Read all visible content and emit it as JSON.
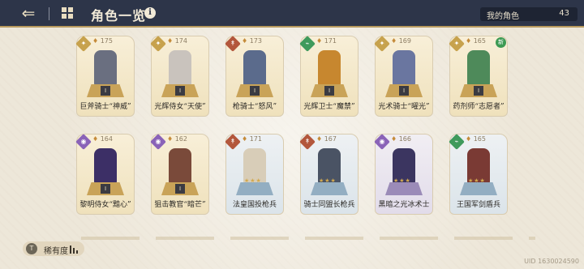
{
  "header": {
    "title": "角色一览",
    "my_chars_label": "我的角色",
    "my_chars_count": "43"
  },
  "cards": [
    {
      "power": "175",
      "name": "巨斧骑士“神威”",
      "rank": "I",
      "badge": "gold",
      "frame": "gold",
      "sprite": "#6a6f80",
      "new": false
    },
    {
      "power": "174",
      "name": "光辉侍女“天使”",
      "rank": "I",
      "badge": "gold",
      "frame": "gold",
      "sprite": "#c9c3bd",
      "new": false
    },
    {
      "power": "173",
      "name": "枪骑士“怒风”",
      "rank": "I",
      "badge": "red",
      "frame": "gold",
      "sprite": "#5b6b8c",
      "new": false
    },
    {
      "power": "171",
      "name": "光辉卫士“魔禁”",
      "rank": "I",
      "badge": "green",
      "frame": "gold",
      "sprite": "#c7872f",
      "new": false
    },
    {
      "power": "169",
      "name": "光术骑士“曜光”",
      "rank": "I",
      "badge": "gold",
      "frame": "gold",
      "sprite": "#6a76a0",
      "new": false
    },
    {
      "power": "165",
      "name": "药剂师“志愿者”",
      "rank": "I",
      "badge": "gold",
      "frame": "gold",
      "sprite": "#4e8a5a",
      "new": true,
      "new_label": "新"
    },
    {
      "power": "164",
      "name": "黎明侍女“黯心”",
      "rank": "I",
      "badge": "purple",
      "frame": "gold",
      "sprite": "#3c2f66",
      "new": false
    },
    {
      "power": "162",
      "name": "狙击教官“暗芒”",
      "rank": "I",
      "badge": "purple",
      "frame": "gold",
      "sprite": "#7a4a3a",
      "new": false
    },
    {
      "power": "171",
      "name": "法皇国投枪兵",
      "rank": "",
      "badge": "red",
      "frame": "blue",
      "sprite": "#d8cdb8",
      "new": false,
      "stars": "★★★"
    },
    {
      "power": "167",
      "name": "骑士同盟长枪兵",
      "rank": "",
      "badge": "red",
      "frame": "blue",
      "sprite": "#4a5364",
      "new": false,
      "stars": "★★★"
    },
    {
      "power": "166",
      "name": "黑暗之光冰术士",
      "rank": "",
      "badge": "purple",
      "frame": "purple",
      "sprite": "#3b3560",
      "new": false,
      "stars": "★★★"
    },
    {
      "power": "165",
      "name": "王国军剑盾兵",
      "rank": "",
      "badge": "green",
      "frame": "blue",
      "sprite": "#7a3a34",
      "new": false,
      "stars": "★★★"
    }
  ],
  "footer": {
    "rarity_label": "稀有度",
    "uid": "UID 1630024590"
  }
}
